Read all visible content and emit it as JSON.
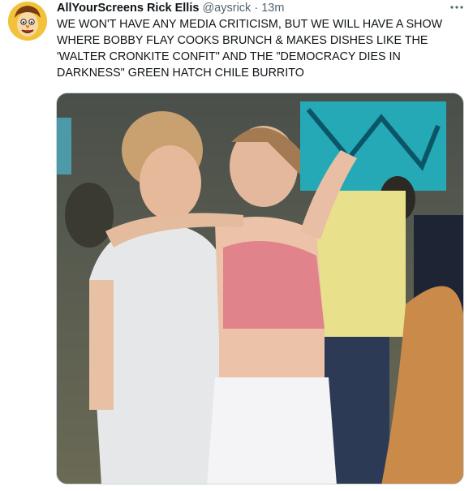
{
  "tweet": {
    "author_name": "AllYourScreens Rick Ellis",
    "author_handle": "@aysrick",
    "separator": "·",
    "timestamp": "13m",
    "more_icon": "more-icon",
    "text_lines": [
      "WE WON'T HAVE ANY MEDIA CRITICISM, BUT WE WILL HAVE A SHOW",
      "WHERE BOBBY FLAY COOKS BRUNCH & MAKES DISHES LIKE THE",
      "'WALTER CRONKITE CONFIT\" AND THE \"DEMOCRACY DIES IN",
      "DARKNESS\" GREEN HATCH CHILE BURRITO"
    ],
    "avatar_icon": "cartoon-face-avatar",
    "media_kind": "photo",
    "colors": {
      "avatar_bg": "#f2c23a",
      "text": "#0f1419",
      "muted": "#536471"
    }
  }
}
